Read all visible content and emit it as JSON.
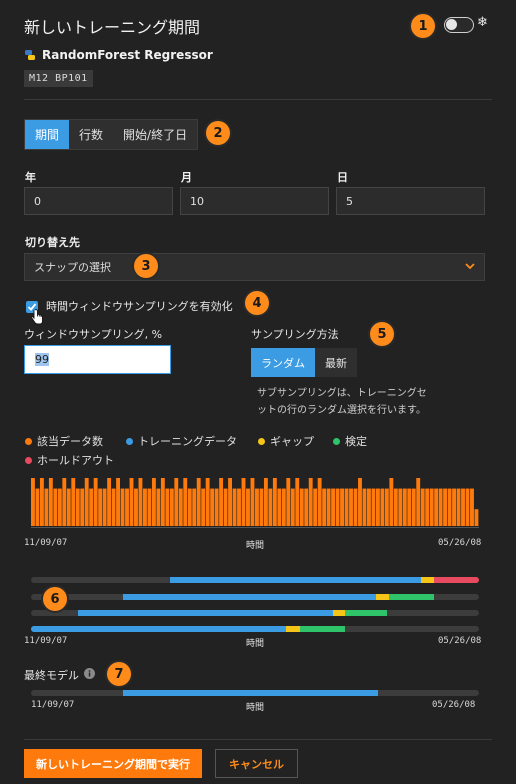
{
  "header": {
    "title": "新しいトレーニング期間",
    "model_name": "RandomForest Regressor",
    "model_tag": "M12  BP101"
  },
  "badges": [
    "1",
    "2",
    "3",
    "4",
    "5",
    "6",
    "7"
  ],
  "tabs": [
    {
      "label": "期間",
      "active": true
    },
    {
      "label": "行数",
      "active": false
    },
    {
      "label": "開始/終了日",
      "active": false
    }
  ],
  "date": {
    "year_label": "年",
    "year_value": "0",
    "month_label": "月",
    "month_value": "10",
    "day_label": "日",
    "day_value": "5"
  },
  "switch": {
    "label": "切り替え先",
    "placeholder": "スナップの選択"
  },
  "window_sampling": {
    "checkbox_label": "時間ウィンドウサンプリングを有効化",
    "checked": true,
    "field_label": "ウィンドウサンプリング, %",
    "value": "99"
  },
  "sampling": {
    "label": "サンプリング方法",
    "options": [
      {
        "label": "ランダム",
        "active": true
      },
      {
        "label": "最新",
        "active": false
      }
    ],
    "description": "サブサンプリングは、トレーニングセットの行のランダム選択を行います。"
  },
  "legend": [
    {
      "label": "該当データ数",
      "color": "#ff7a0d"
    },
    {
      "label": "トレーニングデータ",
      "color": "#3b9ce4"
    },
    {
      "label": "ギャップ",
      "color": "#f5c518"
    },
    {
      "label": "検定",
      "color": "#2fc46a"
    },
    {
      "label": "ホールドアウト",
      "color": "#e84a5f"
    }
  ],
  "axis": {
    "start": "11/09/07",
    "mid": "時間",
    "end": "05/26/08"
  },
  "chart_data": {
    "type": "bar",
    "values": [
      1,
      0.78,
      1,
      0.78,
      1,
      0.78,
      0.78,
      1,
      0.78,
      1,
      0.78,
      0.78,
      1,
      0.78,
      1,
      0.78,
      0.78,
      1,
      0.78,
      1,
      0.78,
      0.78,
      1,
      0.78,
      1,
      0.78,
      0.78,
      1,
      0.78,
      1,
      0.78,
      0.78,
      1,
      0.78,
      1,
      0.78,
      0.78,
      1,
      0.78,
      1,
      0.78,
      0.78,
      1,
      0.78,
      1,
      0.78,
      0.78,
      1,
      0.78,
      1,
      0.78,
      0.78,
      1,
      0.78,
      1,
      0.78,
      0.78,
      1,
      0.78,
      1,
      0.78,
      0.78,
      1,
      0.78,
      1,
      0.78,
      0.78,
      0.78,
      0.78,
      0.78,
      0.78,
      0.78,
      0.78,
      1,
      0.78,
      0.78,
      0.78,
      0.78,
      0.78,
      0.78,
      1,
      0.78,
      0.78,
      0.78,
      0.78,
      0.78,
      1,
      0.78,
      0.78,
      0.78,
      0.78,
      0.78,
      0.78,
      0.78,
      0.78,
      0.78,
      0.78,
      0.78,
      0.78,
      0.35
    ],
    "color": "#ff7a0d"
  },
  "backtests": [
    [
      {
        "start": 0.31,
        "end": 0.87,
        "color": "#3b9ce4"
      },
      {
        "start": 0.87,
        "end": 0.9,
        "color": "#f5c518"
      },
      {
        "start": 0.9,
        "end": 1.0,
        "color": "#e84a5f"
      }
    ],
    [
      {
        "start": 0.205,
        "end": 0.77,
        "color": "#3b9ce4"
      },
      {
        "start": 0.77,
        "end": 0.8,
        "color": "#f5c518"
      },
      {
        "start": 0.8,
        "end": 0.9,
        "color": "#2fc46a"
      }
    ],
    [
      {
        "start": 0.105,
        "end": 0.675,
        "color": "#3b9ce4"
      },
      {
        "start": 0.675,
        "end": 0.7,
        "color": "#f5c518"
      },
      {
        "start": 0.7,
        "end": 0.795,
        "color": "#2fc46a"
      }
    ],
    [
      {
        "start": 0.0,
        "end": 0.57,
        "color": "#3b9ce4"
      },
      {
        "start": 0.57,
        "end": 0.6,
        "color": "#f5c518"
      },
      {
        "start": 0.6,
        "end": 0.7,
        "color": "#2fc46a"
      }
    ]
  ],
  "final_model": {
    "label": "最終モデル",
    "bar": {
      "start": 0.205,
      "end": 0.775,
      "color": "#3b9ce4"
    }
  },
  "actions": {
    "run_label": "新しいトレーニング期間で実行",
    "cancel_label": "キャンセル"
  }
}
